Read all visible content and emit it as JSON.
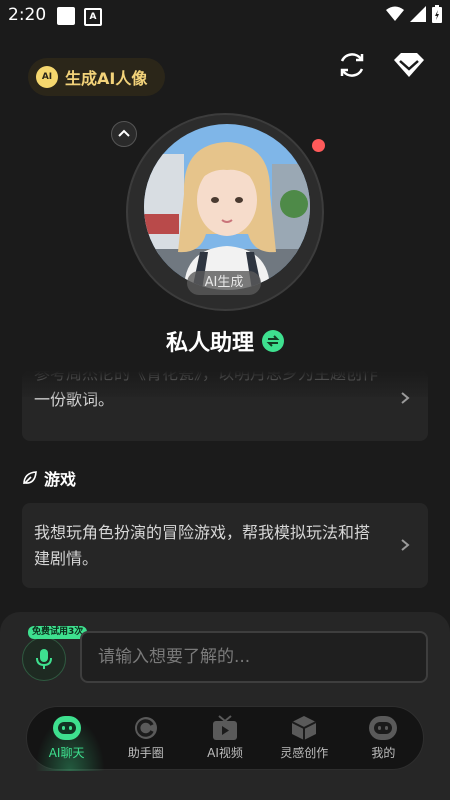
{
  "status": {
    "time": "2:20"
  },
  "header": {
    "generate_label": "生成AI人像",
    "generate_icon_text": "AI"
  },
  "assistant": {
    "badge": "AI生成",
    "name": "私人助理"
  },
  "prompts": {
    "song_card": "参考周杰伦的《青花瓷》，以明月思乡为主题创作一份歌词。",
    "game_section_title": "游戏",
    "game_card": "我想玩角色扮演的冒险游戏，帮我模拟玩法和搭建剧情。"
  },
  "input": {
    "trial_tag": "免费试用3次",
    "placeholder": "请输入想要了解的..."
  },
  "nav": {
    "items": [
      {
        "label": "AI聊天",
        "icon": "robot-face-icon",
        "active": true
      },
      {
        "label": "助手圈",
        "icon": "circle-icon"
      },
      {
        "label": "AI视频",
        "icon": "video-icon"
      },
      {
        "label": "灵感创作",
        "icon": "box-icon"
      },
      {
        "label": "我的",
        "icon": "profile-robot-icon"
      }
    ]
  },
  "colors": {
    "accent": "#3ee08f",
    "gold": "#f3d37a",
    "background": "#1b1b1b",
    "card": "#262626",
    "notification": "#ff5a5a"
  }
}
